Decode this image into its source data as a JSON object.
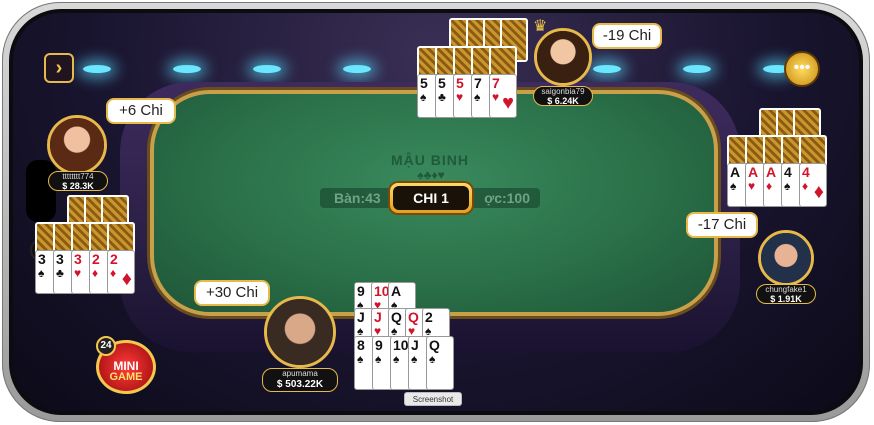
{
  "table": {
    "name": "MẬU BINH",
    "suits": "♠♣♦♥",
    "bet_label": "Bàn:43",
    "round_label": "ợc:100",
    "round_badge": "CHI 1"
  },
  "players": {
    "top": {
      "name": "saigonbia79",
      "money": "$ 6.24K",
      "bubble": "-19 Chi"
    },
    "left": {
      "name": "tttttttt774",
      "money": "$ 28.3K",
      "bubble": "+6 Chi"
    },
    "right": {
      "name": "chungfake1",
      "money": "$ 1.91K",
      "bubble": "-17 Chi"
    },
    "me": {
      "name": "apumama",
      "money": "$ 503.22K",
      "bubble": "+30 Chi"
    }
  },
  "top_cards": [
    {
      "rank": "5",
      "suit": "♠",
      "color": "blk"
    },
    {
      "rank": "5",
      "suit": "♣",
      "color": "blk"
    },
    {
      "rank": "5",
      "suit": "♥",
      "color": "red"
    },
    {
      "rank": "7",
      "suit": "♠",
      "color": "blk"
    },
    {
      "rank": "7",
      "suit": "♥",
      "color": "red"
    }
  ],
  "right_cards": [
    {
      "rank": "A",
      "suit": "♠",
      "color": "blk"
    },
    {
      "rank": "A",
      "suit": "♥",
      "color": "red"
    },
    {
      "rank": "A",
      "suit": "♦",
      "color": "red"
    },
    {
      "rank": "4",
      "suit": "♠",
      "color": "blk"
    },
    {
      "rank": "4",
      "suit": "♦",
      "color": "red"
    }
  ],
  "left_cards": [
    {
      "rank": "3",
      "suit": "♠",
      "color": "blk"
    },
    {
      "rank": "3",
      "suit": "♣",
      "color": "blk"
    },
    {
      "rank": "3",
      "suit": "♥",
      "color": "red"
    },
    {
      "rank": "2",
      "suit": "♦",
      "color": "red"
    },
    {
      "rank": "2",
      "suit": "♦",
      "color": "red"
    }
  ],
  "my_hand": {
    "row1": [
      {
        "rank": "9",
        "suit": "♠",
        "color": "blk"
      },
      {
        "rank": "10",
        "suit": "♥",
        "color": "red"
      },
      {
        "rank": "A",
        "suit": "♠",
        "color": "blk"
      }
    ],
    "row2": [
      {
        "rank": "J",
        "suit": "♠",
        "color": "blk"
      },
      {
        "rank": "J",
        "suit": "♥",
        "color": "red"
      },
      {
        "rank": "Q",
        "suit": "♠",
        "color": "blk"
      },
      {
        "rank": "Q",
        "suit": "♥",
        "color": "red"
      },
      {
        "rank": "2",
        "suit": "♠",
        "color": "blk"
      }
    ],
    "row3": [
      {
        "rank": "8",
        "suit": "♠",
        "color": "blk"
      },
      {
        "rank": "9",
        "suit": "♠",
        "color": "blk"
      },
      {
        "rank": "10",
        "suit": "♠",
        "color": "blk"
      },
      {
        "rank": "J",
        "suit": "♠",
        "color": "blk"
      },
      {
        "rank": "Q",
        "suit": "♠",
        "color": "blk"
      }
    ]
  },
  "controls": {
    "exit_icon": "chevron-right-icon",
    "chat_icon": "chat-icon",
    "exit_glyph": "›",
    "chat_glyph": "•••"
  },
  "mini_game": {
    "count": "24",
    "line1": "MINI",
    "line2": "GAME"
  },
  "tooltip": "Screenshot",
  "colors": {
    "felt": "#2a7048",
    "gold": "#e7b84a",
    "red_suit": "#d0142c"
  }
}
